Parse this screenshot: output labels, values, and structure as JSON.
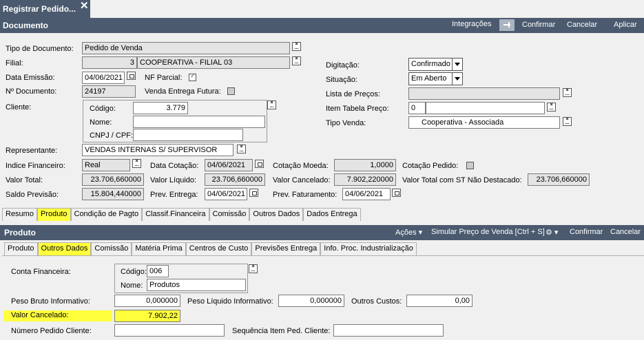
{
  "window_tab": {
    "title": "Registrar Pedido...",
    "close": "✕"
  },
  "document_bar": {
    "title": "Documento",
    "integracoes": "Integrações",
    "confirmar": "Confirmar",
    "cancelar": "Cancelar",
    "aplicar": "Aplicar"
  },
  "form": {
    "tipo_documento": {
      "label": "Tipo de Documento:",
      "value": "Pedido de Venda"
    },
    "filial": {
      "label": "Filial:",
      "code": "3",
      "value": "COOPERATIVA - FILIAL 03"
    },
    "data_emissao": {
      "label": "Data Emissão:",
      "value": "04/06/2021"
    },
    "nf_parcial": {
      "label": "NF Parcial:"
    },
    "n_documento": {
      "label": "Nº Documento:",
      "value": "24197"
    },
    "venda_entrega_futura": {
      "label": "Venda Entrega Futura:"
    },
    "cliente": {
      "label": "Cliente:",
      "codigo_label": "Código:",
      "codigo": "3.779",
      "nome_label": "Nome:",
      "nome": "",
      "cnpj_label": "CNPJ / CPF:",
      "cnpj": ""
    },
    "digitacao": {
      "label": "Digitação:",
      "value": "Confirmado"
    },
    "situacao": {
      "label": "Situação:",
      "value": "Em Aberto"
    },
    "lista_precos": {
      "label": "Lista de Preços:",
      "value": ""
    },
    "item_tabela_preco": {
      "label": "Item Tabela Preço:",
      "code": "0",
      "value": ""
    },
    "tipo_venda": {
      "label": "Tipo Venda:",
      "value": "Cooperativa - Associada"
    },
    "representante": {
      "label": "Representante:",
      "value": "VENDAS INTERNAS S/ SUPERVISOR"
    },
    "indice_financeiro": {
      "label": "Indice Financeiro:",
      "value": "Real"
    },
    "data_cotacao": {
      "label": "Data Cotação:",
      "value": "04/06/2021"
    },
    "cotacao_moeda": {
      "label": "Cotação Moeda:",
      "value": "1,0000"
    },
    "cotacao_pedido": {
      "label": "Cotação Pedido:"
    },
    "valor_total": {
      "label": "Valor Total:",
      "value": "23.706,660000"
    },
    "valor_liquido": {
      "label": "Valor Líquido:",
      "value": "23.706,660000"
    },
    "valor_cancelado": {
      "label": "Valor Cancelado:",
      "value": "7.902,220000"
    },
    "valor_total_st": {
      "label": "Valor Total com ST Não Destacado:",
      "value": "23.706,660000"
    },
    "saldo_previsao": {
      "label": "Saldo Previsão:",
      "value": "15.804,440000"
    },
    "prev_entrega": {
      "label": "Prev. Entrega:",
      "value": "04/06/2021"
    },
    "prev_faturamento": {
      "label": "Prev. Faturamento:",
      "value": "04/06/2021"
    }
  },
  "main_tabs": [
    "Resumo",
    "Produto",
    "Condição de Pagto",
    "Classif.Financeira",
    "Comissão",
    "Outros Dados",
    "Dados Entrega"
  ],
  "produto_bar": {
    "title": "Produto",
    "acoes": "Ações",
    "simular": "Simular Preço de Venda [Ctrl + S]",
    "confirmar": "Confirmar",
    "cancelar": "Cancelar"
  },
  "sub_tabs": [
    "Produto",
    "Outros Dados",
    "Comissão",
    "Matéria Prima",
    "Centros de Custo",
    "Previsões Entrega",
    "Info. Proc. Industrialização"
  ],
  "outros": {
    "conta_financeira": {
      "label": "Conta Financeira:",
      "codigo_label": "Código:",
      "codigo": "006",
      "nome_label": "Nome:",
      "nome": "Produtos"
    },
    "peso_bruto": {
      "label": "Peso Bruto Informativo:",
      "value": "0,000000"
    },
    "peso_liquido": {
      "label": "Peso Líquido Informativo:",
      "value": "0,000000"
    },
    "outros_custos": {
      "label": "Outros Custos:",
      "value": "0,00"
    },
    "valor_cancelado": {
      "label": "Valor Cancelado:",
      "value": "7.902,22"
    },
    "numero_pedido_cliente": {
      "label": "Número Pedido Cliente:",
      "value": ""
    },
    "sequencia_item": {
      "label": "Sequência Item Ped. Cliente:",
      "value": ""
    }
  },
  "colors": {
    "bar": "#4b5a6e",
    "highlight": "#ffff3c"
  }
}
